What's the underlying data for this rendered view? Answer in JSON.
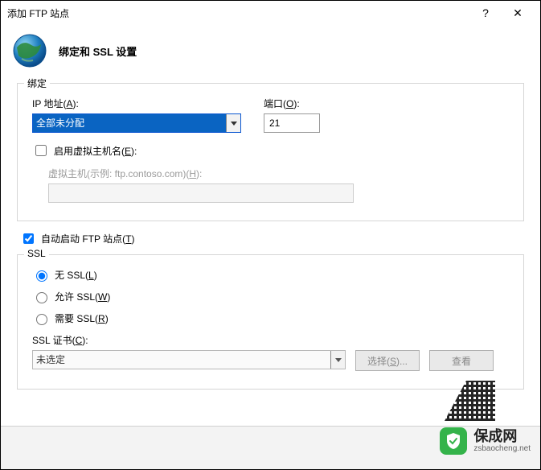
{
  "window": {
    "title": "添加 FTP 站点",
    "help": "?",
    "close": "✕"
  },
  "header": {
    "title": "绑定和 SSL 设置"
  },
  "binding": {
    "legend": "绑定",
    "ip_label_pre": "IP 地址(",
    "ip_label_u": "A",
    "ip_label_post": "):",
    "ip_value": "全部未分配",
    "port_label_pre": "端口(",
    "port_label_u": "O",
    "port_label_post": "):",
    "port_value": "21",
    "vhost_check_pre": "启用虚拟主机名(",
    "vhost_check_u": "E",
    "vhost_check_post": "):",
    "vhost_label_pre": "虚拟主机(示例: ftp.contoso.com)(",
    "vhost_label_u": "H",
    "vhost_label_post": "):",
    "vhost_value": ""
  },
  "autostart": {
    "label_pre": "自动启动 FTP 站点(",
    "label_u": "T",
    "label_post": ")"
  },
  "ssl": {
    "legend": "SSL",
    "no_ssl_pre": "无 SSL(",
    "no_ssl_u": "L",
    "no_ssl_post": ")",
    "allow_ssl_pre": "允许 SSL(",
    "allow_ssl_u": "W",
    "allow_ssl_post": ")",
    "require_ssl_pre": "需要 SSL(",
    "require_ssl_u": "R",
    "require_ssl_post": ")",
    "cert_label_pre": "SSL 证书(",
    "cert_label_u": "C",
    "cert_label_post": "):",
    "cert_value": "未选定",
    "select_btn_pre": "选择(",
    "select_btn_u": "S",
    "select_btn_post": ")...",
    "view_btn": "查看"
  },
  "watermark": {
    "brand": "保成网",
    "url": "zsbaocheng.net"
  }
}
